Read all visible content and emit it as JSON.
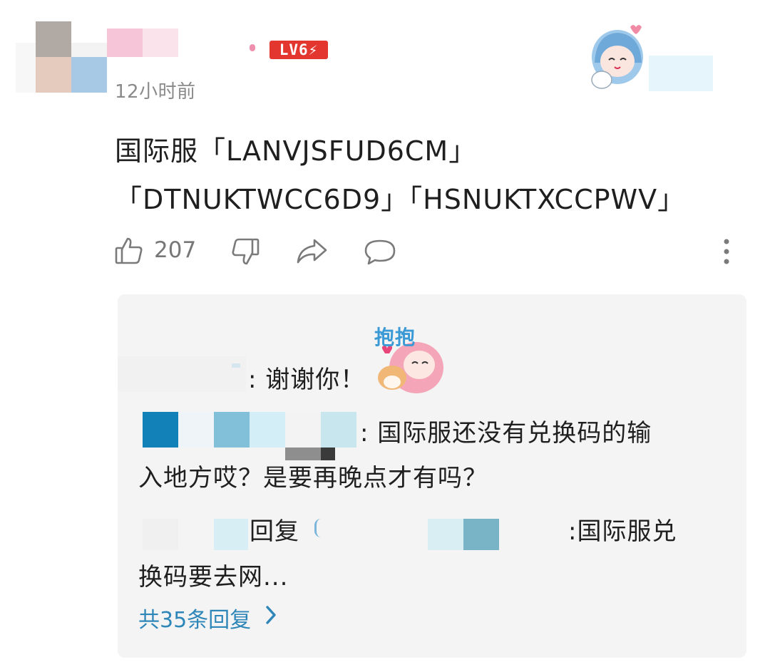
{
  "comment": {
    "time": "12小时前",
    "level_badge": "LV6⚡",
    "text_line1": "国际服「LANVJSFUD6CM」",
    "text_line2": "「DTNUKTWCC6D9」「HSNUKTXCCPWV」",
    "like_count": "207"
  },
  "replies": [
    {
      "text": ": 谢谢你！",
      "sticker_label": "抱抱"
    },
    {
      "text_line1": ": 国际服还没有兑换码的输",
      "text_line2": "入地方哎？是要再晚点才有吗？"
    },
    {
      "reply_word": "回复",
      "text_line1": ":国际服兑",
      "text_line2": "换码要去网..."
    }
  ],
  "more_replies": {
    "label": "共35条回复"
  },
  "icons": {
    "like": "thumb-up-icon",
    "dislike": "thumb-down-icon",
    "share": "share-icon",
    "comment": "comment-icon",
    "more": "more-vertical-icon",
    "chevron": "chevron-right-icon"
  },
  "colors": {
    "badge": "#e2362f",
    "link": "#2f86b8",
    "reply_bg": "#f4f4f4"
  }
}
